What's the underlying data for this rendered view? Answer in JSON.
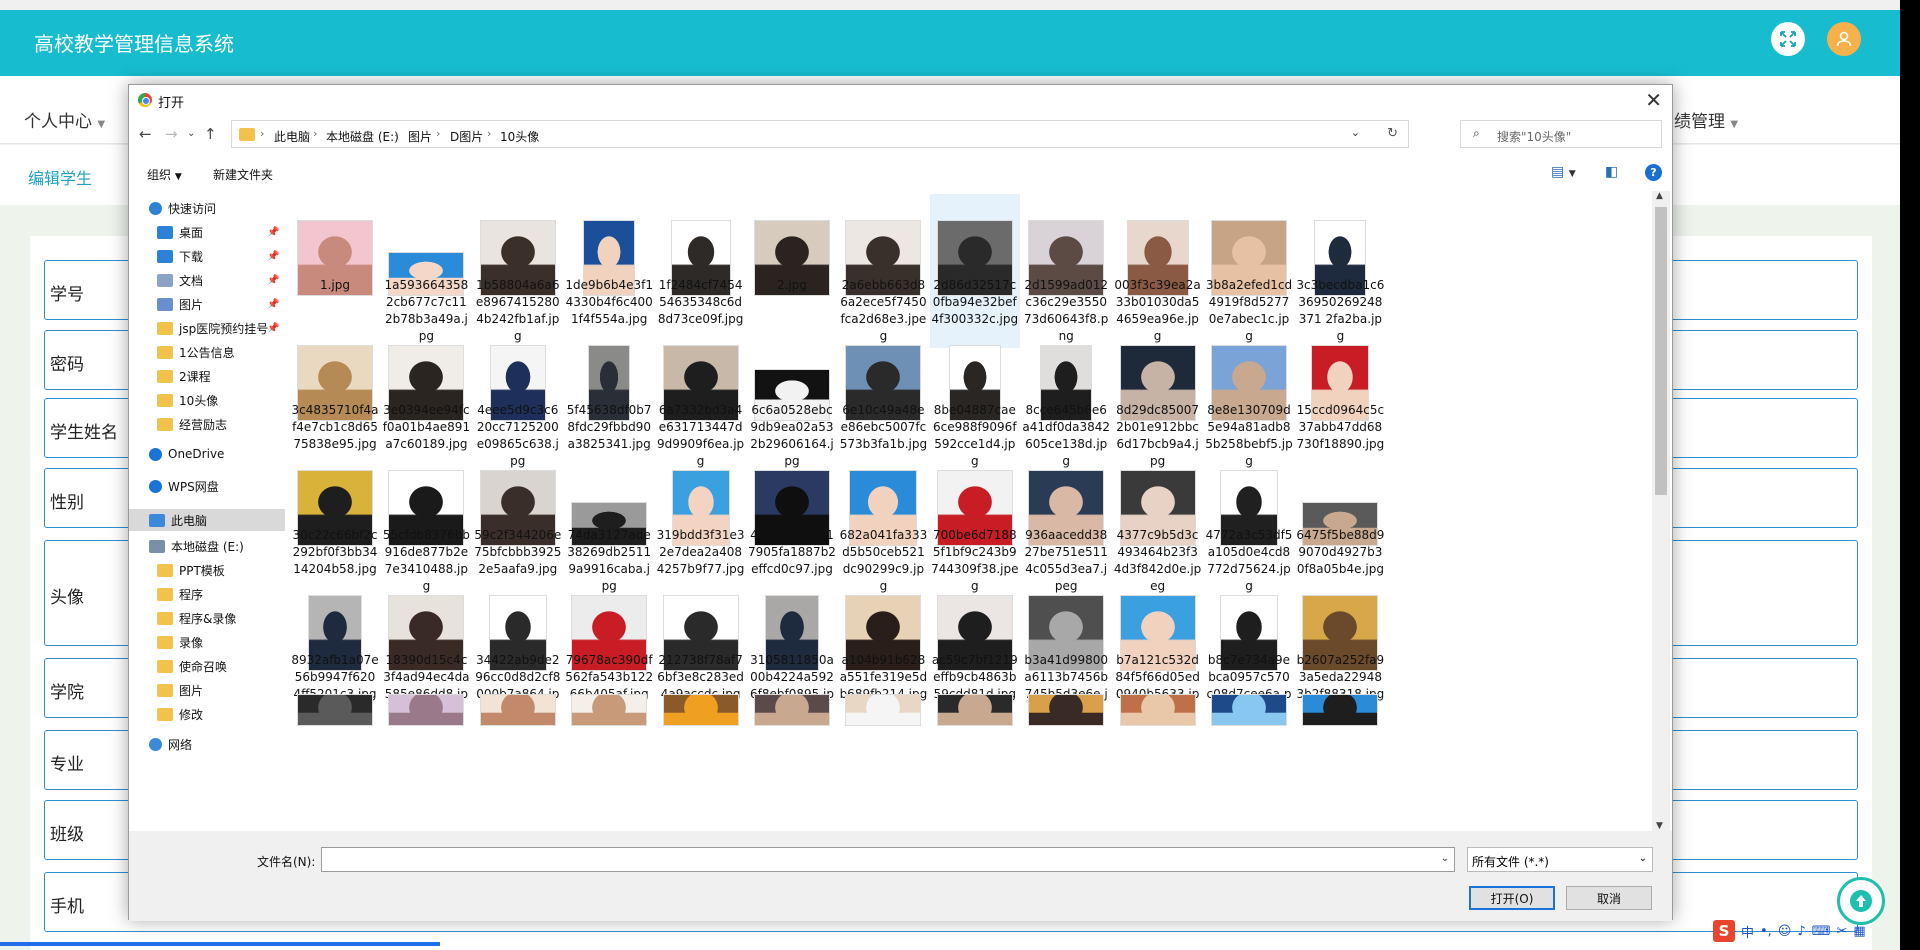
{
  "app": {
    "title": "高校教学管理信息系统",
    "nav_left": "个人中心",
    "nav_right": "绩管理",
    "tab": "编辑学生",
    "form_labels": [
      "学号",
      "密码",
      "学生姓名",
      "性别",
      "头像",
      "学院",
      "专业",
      "班级",
      "手机"
    ]
  },
  "dialog": {
    "title": "打开",
    "close": "✕",
    "path": [
      "此电脑",
      "本地磁盘 (E:)",
      "图片",
      "D图片",
      "10头像"
    ],
    "search_placeholder": "搜索\"10头像\"",
    "organize": "组织",
    "new_folder": "新建文件夹",
    "help": "?",
    "nav": [
      {
        "label": "快速访问",
        "icon": "star-icon"
      },
      {
        "label": "桌面",
        "icon": "desktop-icon",
        "pinned": true
      },
      {
        "label": "下载",
        "icon": "download-icon",
        "pinned": true
      },
      {
        "label": "文档",
        "icon": "document-icon",
        "pinned": true
      },
      {
        "label": "图片",
        "icon": "pictures-icon",
        "pinned": true
      },
      {
        "label": "jsp医院预约挂号",
        "icon": "folder-icon",
        "pinned": true
      },
      {
        "label": "1公告信息",
        "icon": "folder-icon"
      },
      {
        "label": "2课程",
        "icon": "folder-icon"
      },
      {
        "label": "10头像",
        "icon": "folder-icon"
      },
      {
        "label": "经营励志",
        "icon": "folder-icon"
      },
      {
        "label": "OneDrive",
        "icon": "cloud-icon"
      },
      {
        "label": "WPS网盘",
        "icon": "cloud-icon"
      },
      {
        "label": "此电脑",
        "icon": "computer-icon",
        "selected": true
      },
      {
        "label": "本地磁盘 (E:)",
        "icon": "drive-icon"
      },
      {
        "label": "PPT模板",
        "icon": "folder-icon"
      },
      {
        "label": "程序",
        "icon": "folder-icon"
      },
      {
        "label": "程序&录像",
        "icon": "folder-icon"
      },
      {
        "label": "录像",
        "icon": "folder-icon"
      },
      {
        "label": "使命召唤",
        "icon": "folder-icon"
      },
      {
        "label": "图片",
        "icon": "folder-icon"
      },
      {
        "label": "修改",
        "icon": "folder-icon"
      },
      {
        "label": "网络",
        "icon": "network-icon"
      }
    ],
    "files": [
      "1.jpg",
      "1a5936643582cb677c7c112b78b3a49a.jpg",
      "1b58804a6a6e89674152804b242fb1af.jpg",
      "1de9b6b4e3f14330b4f6c4001f4f554a.jpg",
      "1f2484cf745454635348c6d8d73ce09f.jpg",
      "2.jpg",
      "2a6ebb663d86a2ece5f7450fca2d68e3.jpeg",
      "2d86d32517c0fba94e32bef4f300332c.jpg",
      "2d1599ad012c36c29e355073d60643f8.png",
      "003f3c39ea2a33b01030da54659ea96e.jpg",
      "3b8a2efed1cd4919f8d52770e7abec1c.jpg",
      "3c3becdba1c636950269248371 2fa2ba.jpg",
      "3c4835710f4af4e7cb1c8d6575838e95.jpg",
      "3e0394ee94fcf0a01b4ae891a7c60189.jpg",
      "4eee5d9c3c620cc7125200e09865c638.jpg",
      "5f45638df0b78fdc29fbbd90a3825341.jpg",
      "6a7332bd3a4e631713447d9d9909f6ea.jpg",
      "6c6a0528ebc9db9ea02a532b29606164.jpg",
      "6e10c49a48ee86ebc5007fc573b3fa1b.jpg",
      "8be04887cae6ce988f9096f592cce1d4.jpg",
      "8cce645b6e6a41df0da3842605ce138d.jpg",
      "8d29dc850072b01e912bbc6d17bcb9a4.jpg",
      "8e8e130709d5e94a81adb85b258bebf5.jpg",
      "15ccd0964c5c37abb47dd68730f18890.jpg",
      "30c22c66bf2c292bf0f3bb3414204b58.jpg",
      "55cfdb8376bb916de877b2e7e3410488.jpg",
      "59c2f344206e75bfcbbb39252e5aafa9.jpg",
      "74da3127ade38269db25119a9916caba.jpg",
      "319bdd3f31e32e7dea2a4084257b9f77.jpg",
      "469a4a285017905fa1887b2effcd0c97.jpg",
      "682a041fa333d5b50ceb521dc90299c9.jpg",
      "700be6d71885f1bf9c243b9744309f38.jpeg",
      "936aacedd3827be751e5114c055d3ea7.jpeg",
      "4377c9b5d3c493464b23f34d3f842d0e.jpeg",
      "4772a3c53df5a105d0e4cd8772d75624.jpg",
      "6475f5be88d99070d4927b30f8a05b4e.jpg",
      "8932afb1a07e56b9947f6204ff5201c3.jpg",
      "18390d15c4c3f4ad94ec4da585e86dd8.jpg",
      "34422ab9de296cc0d8d2cf8000b7a864.jpeg",
      "79678ac390df562fa543b12266b405af.jpg",
      "212738f78af76bf3e8c283ed4a9accdc.jpg",
      "3105811850a00b4224a5926f8ebf0895.jpg",
      "a104b91b628a551fe319e5db689fb214.jpg",
      "ac59c7bf1219effb9cb4863b59cdd81d.jpg",
      "b3a41d99800a6113b7456b745b5d3e6e.jpg",
      "b7a121c532d84f5f66d05ed0940b5633.jpeg",
      "b8c7e734a9ebca0957c570c08d7cee6a.png",
      "b2607a252fa93a5eda229483b2f88318.jpg",
      "",
      "",
      "",
      "",
      "",
      "",
      "",
      "",
      "",
      "",
      "",
      ""
    ],
    "filename_label": "文件名(N):",
    "filename_value": "",
    "filetype": "所有文件 (*.*)",
    "open": "打开(O)",
    "cancel": "取消"
  },
  "tray": {
    "lang": "中"
  }
}
